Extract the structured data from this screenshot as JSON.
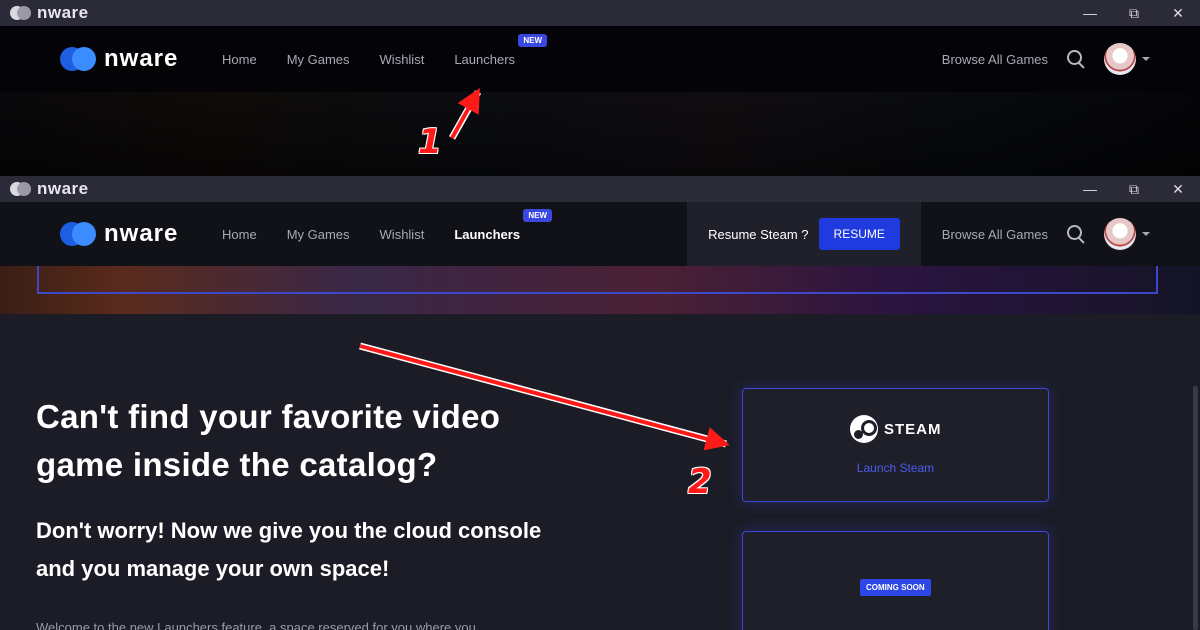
{
  "titlebar": {
    "app_name": "nware",
    "controls": {
      "minimize": "—",
      "restore": "⧉",
      "close": "✕"
    }
  },
  "navbar": {
    "brand": "nware",
    "links": [
      {
        "label": "Home"
      },
      {
        "label": "My Games"
      },
      {
        "label": "Wishlist"
      },
      {
        "label": "Launchers",
        "badge": "NEW"
      }
    ],
    "browse_all": "Browse All Games"
  },
  "resume": {
    "text": "Resume Steam ?",
    "button": "RESUME"
  },
  "main": {
    "title": "Can't find your favorite video game inside the catalog?",
    "subtitle": "Don't worry! Now we give you the cloud console and you manage your own space!",
    "description": "Welcome to the new Launchers feature, a space reserved for you where you"
  },
  "cards": {
    "steam": {
      "logo_text": "STEAM",
      "action": "Launch Steam"
    },
    "soon": {
      "badge": "COMING SOON"
    }
  },
  "annotations": {
    "step1": "1",
    "step2": "2"
  },
  "colors": {
    "accent": "#1f3be0",
    "annotation": "#ff1a1a"
  }
}
